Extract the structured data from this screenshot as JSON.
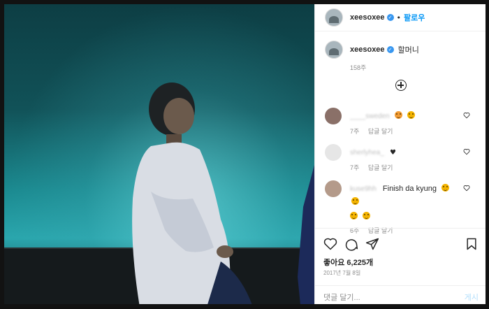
{
  "header": {
    "username": "xeesoxee",
    "separator": "•",
    "follow_label": "팔로우"
  },
  "caption": {
    "username": "xeesoxee",
    "text": "할머니",
    "time": "158주"
  },
  "comments": [
    {
      "name": "____sweden",
      "text": "",
      "emojis": [
        "star-struck-emoji",
        "yum-emoji"
      ],
      "time": "7주",
      "reply": "답글 달기"
    },
    {
      "name": "sherlyhea_",
      "text": "",
      "emojis": [
        "black-heart-emoji"
      ],
      "time": "7주",
      "reply": "답글 달기"
    },
    {
      "name": "kuse9hh",
      "text": "Finish da kyung",
      "emojis": [
        "yum-emoji",
        "yum-emoji",
        "yum-emoji",
        "yum-emoji"
      ],
      "time": "6주",
      "reply": "답글 달기"
    }
  ],
  "actions": {
    "likes_label": "좋아요 6,225개",
    "date": "2017년 7월 8일"
  },
  "add_comment": {
    "placeholder": "댓글 달기...",
    "post_label": "게시"
  },
  "icons": [
    "like-icon",
    "comment-icon",
    "share-icon",
    "save-icon",
    "add-circle-icon",
    "verified-icon",
    "heart-small-icon"
  ],
  "colors": {
    "accent": "#0095f6",
    "verified": "#3897f0",
    "post_disabled": "#b2dffc"
  }
}
